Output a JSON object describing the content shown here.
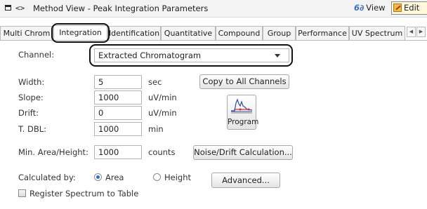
{
  "window": {
    "title": "Method View - Peak Integration Parameters",
    "view_label": "View",
    "edit_label": "Edit"
  },
  "tabs": [
    {
      "label": "Multi Chrom"
    },
    {
      "label": "Integration"
    },
    {
      "label": "Identification"
    },
    {
      "label": "Quantitative"
    },
    {
      "label": "Compound"
    },
    {
      "label": "Group"
    },
    {
      "label": "Performance"
    },
    {
      "label": "UV Spectrum"
    }
  ],
  "form": {
    "channel": {
      "label": "Channel:",
      "value": "Extracted Chromatogram"
    },
    "width": {
      "label": "Width:",
      "value": "5",
      "unit": "sec"
    },
    "slope": {
      "label": "Slope:",
      "value": "1000",
      "unit": "uV/min"
    },
    "drift": {
      "label": "Drift:",
      "value": "0",
      "unit": "uV/min"
    },
    "tdbl": {
      "label": "T. DBL:",
      "value": "1000",
      "unit": "min"
    },
    "min_area": {
      "label": "Min. Area/Height:",
      "value": "1000",
      "unit": "counts"
    },
    "calculated_by": {
      "label": "Calculated by:",
      "option_area": "Area",
      "option_height": "Height",
      "selected": "Area"
    },
    "register_spectrum": {
      "label": "Register Spectrum to Table",
      "checked": false
    }
  },
  "buttons": {
    "copy_all": "Copy to All Channels",
    "program": "Program",
    "noise_drift": "Noise/Drift Calculation...",
    "advanced": "Advanced..."
  }
}
